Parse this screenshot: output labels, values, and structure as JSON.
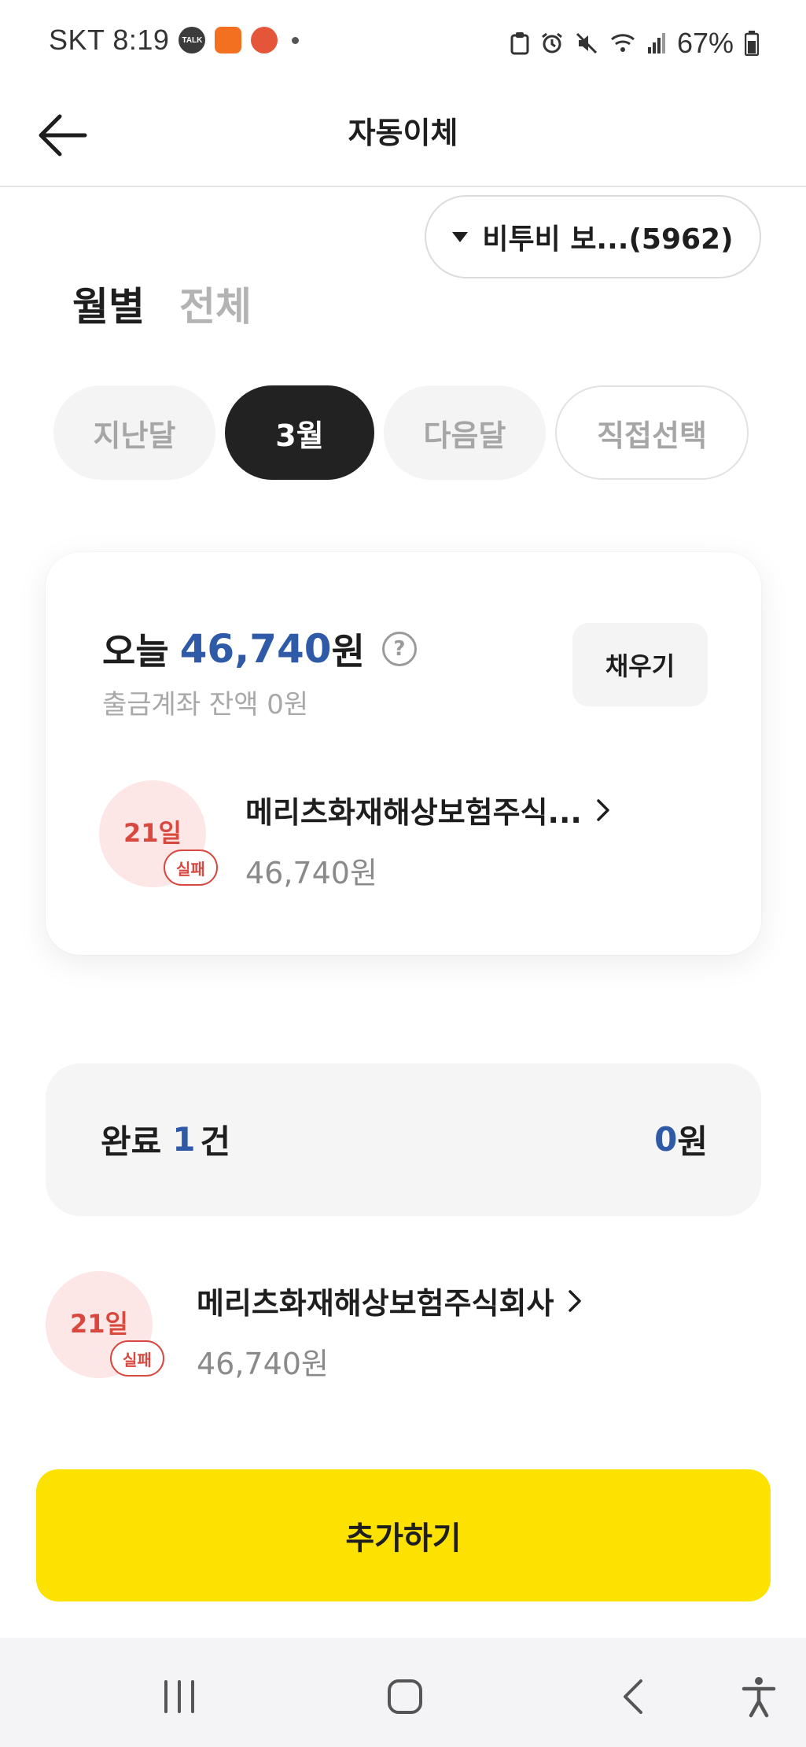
{
  "status_bar": {
    "carrier_time": "SKT 8:19",
    "notifications": [
      "TALK",
      "",
      ""
    ],
    "battery": "67%"
  },
  "header": {
    "title": "자동이체"
  },
  "account_selector": {
    "label": "비투비 보...(5962)"
  },
  "view_tabs": [
    {
      "label": "월별",
      "active": true
    },
    {
      "label": "전체",
      "active": false
    }
  ],
  "month_chips": [
    {
      "label": "지난달"
    },
    {
      "label": "3월"
    },
    {
      "label": "다음달"
    },
    {
      "label": "직접선택"
    }
  ],
  "today_card": {
    "label": "오늘",
    "amount": "46,740",
    "unit": "원",
    "help": "?",
    "balance": "출금계좌 잔액 0원",
    "fill_label": "채우기",
    "item": {
      "date": "21일",
      "status": "실패",
      "name": "메리츠화재해상보험주식...",
      "amount": "46,740원"
    }
  },
  "done_summary": {
    "label": "완료",
    "count": "1",
    "count_unit": "건",
    "amount": "0",
    "amount_unit": "원"
  },
  "list_items": [
    {
      "date": "21일",
      "status": "실패",
      "name": "메리츠화재해상보험주식회사",
      "amount": "46,740원"
    }
  ],
  "add_button": {
    "label": "추가하기"
  },
  "colors": {
    "accent_blue": "#2f5aa8",
    "fail_red": "#d8483f",
    "yellow": "#fde100"
  }
}
